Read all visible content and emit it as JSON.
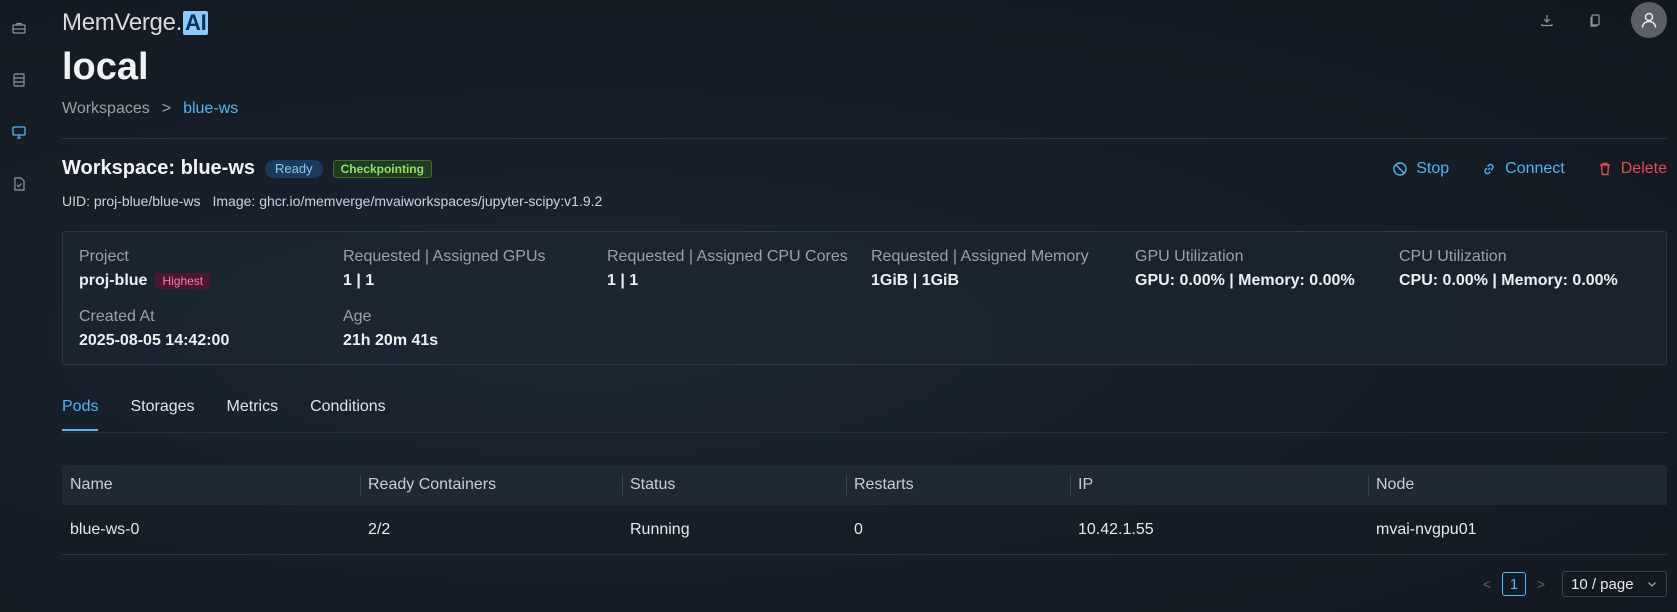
{
  "app": {
    "logo_text": "MemVerge.",
    "logo_badge": "AI",
    "cluster_title": "local"
  },
  "breadcrumb": {
    "parent": "Workspaces",
    "separator": ">",
    "current": "blue-ws"
  },
  "workspace": {
    "title": "Workspace: blue-ws",
    "status_ready": "Ready",
    "status_checkpointing": "Checkpointing",
    "uid": "UID: proj-blue/blue-ws",
    "image": "Image: ghcr.io/memverge/mvaiworkspaces/jupyter-scipy:v1.9.2"
  },
  "actions": {
    "stop": "Stop",
    "connect": "Connect",
    "delete": "Delete"
  },
  "details": {
    "project_label": "Project",
    "project_value": "proj-blue",
    "priority_badge": "Highest",
    "gpus_label": "Requested | Assigned GPUs",
    "gpus_value": "1 | 1",
    "cpu_label": "Requested | Assigned CPU Cores",
    "cpu_value": "1 | 1",
    "memory_label": "Requested | Assigned Memory",
    "memory_value": "1GiB | 1GiB",
    "gpu_util_label": "GPU Utilization",
    "gpu_util_value": "GPU: 0.00% | Memory: 0.00%",
    "cpu_util_label": "CPU Utilization",
    "cpu_util_value": "CPU: 0.00% | Memory: 0.00%",
    "created_label": "Created At",
    "created_value": "2025-08-05 14:42:00",
    "age_label": "Age",
    "age_value": "21h 20m 41s"
  },
  "tabs": [
    "Pods",
    "Storages",
    "Metrics",
    "Conditions"
  ],
  "table": {
    "headers": [
      "Name",
      "Ready Containers",
      "Status",
      "Restarts",
      "IP",
      "Node"
    ],
    "rows": [
      [
        "blue-ws-0",
        "2/2",
        "Running",
        "0",
        "10.42.1.55",
        "mvai-nvgpu01"
      ]
    ]
  },
  "pagination": {
    "prev": "<",
    "page": "1",
    "next": ">",
    "page_size": "10 / page"
  },
  "colors": {
    "accent": "#4fb5f5",
    "danger": "#e5484d",
    "background": "#131922"
  },
  "icons": {
    "sidebar": [
      "briefcase-icon",
      "server-list-icon",
      "monitor-icon",
      "checklist-icon"
    ],
    "topbar": [
      "download-icon",
      "copy-icon",
      "user-avatar-icon"
    ]
  }
}
